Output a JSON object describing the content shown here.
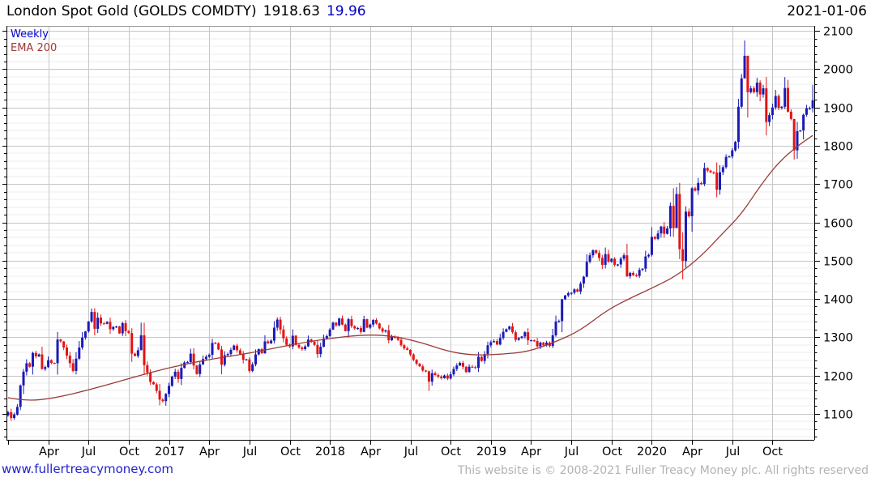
{
  "header": {
    "title": "London Spot Gold (GOLDS COMDTY)",
    "price": "1918.63",
    "change": "19.96",
    "date": "2021-01-06"
  },
  "legend": {
    "timeframe_label": "Weekly",
    "ema_label": "EMA 200"
  },
  "footer": {
    "site_link": "www.fullertreacymoney.com",
    "copyright": "This website is © 2008-2021 Fuller Treacy Money plc. All rights reserved"
  },
  "chart_data": {
    "type": "candlestick",
    "timeframe": "weekly",
    "title": "London Spot Gold (GOLDS COMDTY)",
    "last_price": 1918.63,
    "last_change": 19.96,
    "overlay": "EMA 200",
    "ylim": [
      1032,
      2113
    ],
    "y_ticks": [
      1100,
      1200,
      1300,
      1400,
      1500,
      1600,
      1700,
      1800,
      1900,
      2000,
      2100
    ],
    "y_minor_step": 20,
    "grid": true,
    "x_ticks": [
      {
        "label": "Apr",
        "week": 13
      },
      {
        "label": "Jul",
        "week": 26
      },
      {
        "label": "Oct",
        "week": 39
      },
      {
        "label": "2017",
        "week": 52
      },
      {
        "label": "Apr",
        "week": 65
      },
      {
        "label": "Jul",
        "week": 78
      },
      {
        "label": "Oct",
        "week": 91
      },
      {
        "label": "2018",
        "week": 104
      },
      {
        "label": "Apr",
        "week": 117
      },
      {
        "label": "Jul",
        "week": 130
      },
      {
        "label": "Oct",
        "week": 143
      },
      {
        "label": "2019",
        "week": 156
      },
      {
        "label": "Apr",
        "week": 169
      },
      {
        "label": "Jul",
        "week": 182
      },
      {
        "label": "Oct",
        "week": 195
      },
      {
        "label": "2020",
        "week": 208
      },
      {
        "label": "Apr",
        "week": 221
      },
      {
        "label": "Jul",
        "week": 234
      },
      {
        "label": "Oct",
        "week": 247
      }
    ],
    "years": [
      "2016",
      "2017",
      "2018",
      "2019",
      "2020",
      "2021"
    ],
    "first_open": 1096,
    "weekly_closes": {
      "2016": [
        1104,
        1089,
        1098,
        1118,
        1174,
        1210,
        1232,
        1223,
        1259,
        1250,
        1255,
        1217,
        1222,
        1240,
        1233,
        1232,
        1294,
        1289,
        1273,
        1252,
        1232,
        1212,
        1244,
        1273,
        1299,
        1315,
        1341,
        1366,
        1322,
        1351,
        1336,
        1335,
        1340,
        1321,
        1327,
        1328,
        1310,
        1337,
        1316,
        1311,
        1257,
        1251,
        1266,
        1305,
        1227,
        1208,
        1183,
        1177,
        1160,
        1137,
        1133,
        1152
      ],
      "2017": [
        1173,
        1197,
        1210,
        1191,
        1220,
        1234,
        1235,
        1257,
        1226,
        1204,
        1229,
        1243,
        1249,
        1254,
        1285,
        1284,
        1268,
        1228,
        1253,
        1256,
        1267,
        1278,
        1266,
        1256,
        1241,
        1242,
        1212,
        1229,
        1255,
        1269,
        1258,
        1289,
        1284,
        1291,
        1325,
        1346,
        1320,
        1297,
        1280,
        1276,
        1304,
        1280,
        1273,
        1269,
        1276,
        1294,
        1288,
        1280,
        1256,
        1275,
        1297,
        1303
      ],
      "2018": [
        1320,
        1338,
        1331,
        1349,
        1333,
        1316,
        1347,
        1329,
        1323,
        1324,
        1314,
        1347,
        1325,
        1333,
        1345,
        1336,
        1323,
        1315,
        1318,
        1292,
        1301,
        1298,
        1293,
        1279,
        1271,
        1267,
        1255,
        1241,
        1231,
        1224,
        1213,
        1211,
        1184,
        1206,
        1201,
        1197,
        1193,
        1200,
        1192,
        1203,
        1217,
        1226,
        1233,
        1223,
        1209,
        1223,
        1222,
        1220,
        1249,
        1238,
        1256,
        1279
      ],
      "2019": [
        1287,
        1290,
        1281,
        1298,
        1314,
        1321,
        1328,
        1313,
        1293,
        1298,
        1302,
        1313,
        1292,
        1292,
        1290,
        1276,
        1286,
        1279,
        1286,
        1277,
        1305,
        1341,
        1342,
        1399,
        1409,
        1415,
        1416,
        1425,
        1419,
        1440,
        1458,
        1497,
        1514,
        1527,
        1520,
        1507,
        1489,
        1517,
        1497,
        1505,
        1489,
        1490,
        1505,
        1514,
        1459,
        1468,
        1462,
        1460,
        1476,
        1479,
        1511,
        1515
      ],
      "2020": [
        1562,
        1557,
        1571,
        1589,
        1570,
        1584,
        1643,
        1585,
        1674,
        1530,
        1499,
        1628,
        1616,
        1689,
        1683,
        1703,
        1700,
        1742,
        1735,
        1731,
        1730,
        1685,
        1731,
        1744,
        1771,
        1772,
        1788,
        1810,
        1902,
        1976,
        2035,
        1940,
        1950,
        1940,
        1965,
        1934,
        1950,
        1862,
        1880,
        1900,
        1930,
        1899,
        1902,
        1951,
        1889,
        1870,
        1788,
        1838,
        1840,
        1881,
        1898,
        1898
      ],
      "2021": [
        1918.63
      ]
    },
    "wick_overrides": {
      "27": [
        1375,
        1337
      ],
      "43": [
        1338,
        1270
      ],
      "49": [
        1178,
        1122
      ],
      "136": [
        1213,
        1160
      ],
      "214": [
        1652,
        1563
      ],
      "215": [
        1689,
        1562
      ],
      "216": [
        1692,
        1641
      ],
      "217": [
        1703,
        1504
      ],
      "218": [
        1574,
        1451
      ],
      "219": [
        1642,
        1482
      ],
      "238": [
        2075,
        1985
      ],
      "239": [
        2030,
        1874
      ],
      "254": [
        1818,
        1764
      ],
      "260": [
        1959,
        1887
      ]
    },
    "ema_points": [
      [
        0,
        1142
      ],
      [
        6,
        1133
      ],
      [
        15,
        1141
      ],
      [
        26,
        1162
      ],
      [
        39,
        1192
      ],
      [
        52,
        1221
      ],
      [
        65,
        1242
      ],
      [
        78,
        1258
      ],
      [
        91,
        1280
      ],
      [
        104,
        1297
      ],
      [
        114,
        1306
      ],
      [
        123,
        1305
      ],
      [
        133,
        1288
      ],
      [
        142,
        1263
      ],
      [
        150,
        1253
      ],
      [
        159,
        1255
      ],
      [
        168,
        1262
      ],
      [
        177,
        1288
      ],
      [
        185,
        1318
      ],
      [
        193,
        1368
      ],
      [
        201,
        1402
      ],
      [
        208,
        1428
      ],
      [
        216,
        1460
      ],
      [
        224,
        1512
      ],
      [
        231,
        1572
      ],
      [
        237,
        1622
      ],
      [
        243,
        1695
      ],
      [
        249,
        1757
      ],
      [
        255,
        1799
      ],
      [
        260,
        1827
      ]
    ],
    "colors": {
      "up": "#1a1ab8",
      "down": "#e31414",
      "ema": "#9a3c38",
      "grid_major": "#c6c6c6",
      "grid_minor": "#ececec",
      "axis": "#000000",
      "top_border": "#999999",
      "change_text": "#0000cc",
      "link_text": "#2222cc",
      "copyright_text": "#b3b3b3"
    }
  }
}
